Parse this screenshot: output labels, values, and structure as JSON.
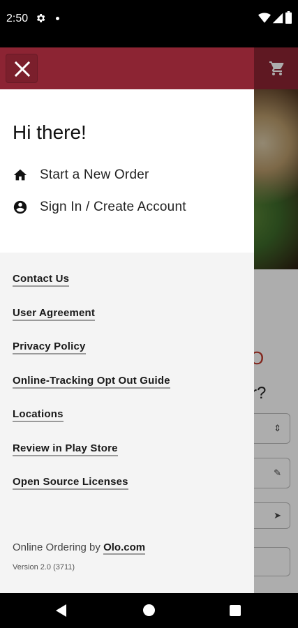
{
  "status_bar": {
    "time": "2:50",
    "icons": [
      "gear-icon",
      "notification-dot-icon",
      "wifi-icon",
      "cell-signal-icon",
      "battery-icon"
    ]
  },
  "colors": {
    "brand": "#8c2433",
    "drawer_background": "#f4f4f4",
    "text": "#111111"
  },
  "background_app": {
    "cart_icon": "cart-icon",
    "fragments": [
      "O",
      "r?"
    ]
  },
  "drawer": {
    "close_icon": "close-icon",
    "greeting": "Hi there!",
    "menu": [
      {
        "icon": "home-icon",
        "label": "Start a New Order"
      },
      {
        "icon": "account-circle-icon",
        "label": "Sign In / Create Account"
      }
    ],
    "links": [
      "Contact Us",
      "User Agreement",
      "Privacy Policy",
      "Online-Tracking Opt Out Guide",
      "Locations",
      "Review in Play Store",
      "Open Source Licenses"
    ],
    "footer": {
      "prefix": "Online Ordering by ",
      "link": "Olo.com",
      "version": "Version 2.0 (3711)"
    }
  },
  "nav_bar": {
    "buttons": [
      "back-icon",
      "home-circle-icon",
      "recents-icon"
    ]
  }
}
